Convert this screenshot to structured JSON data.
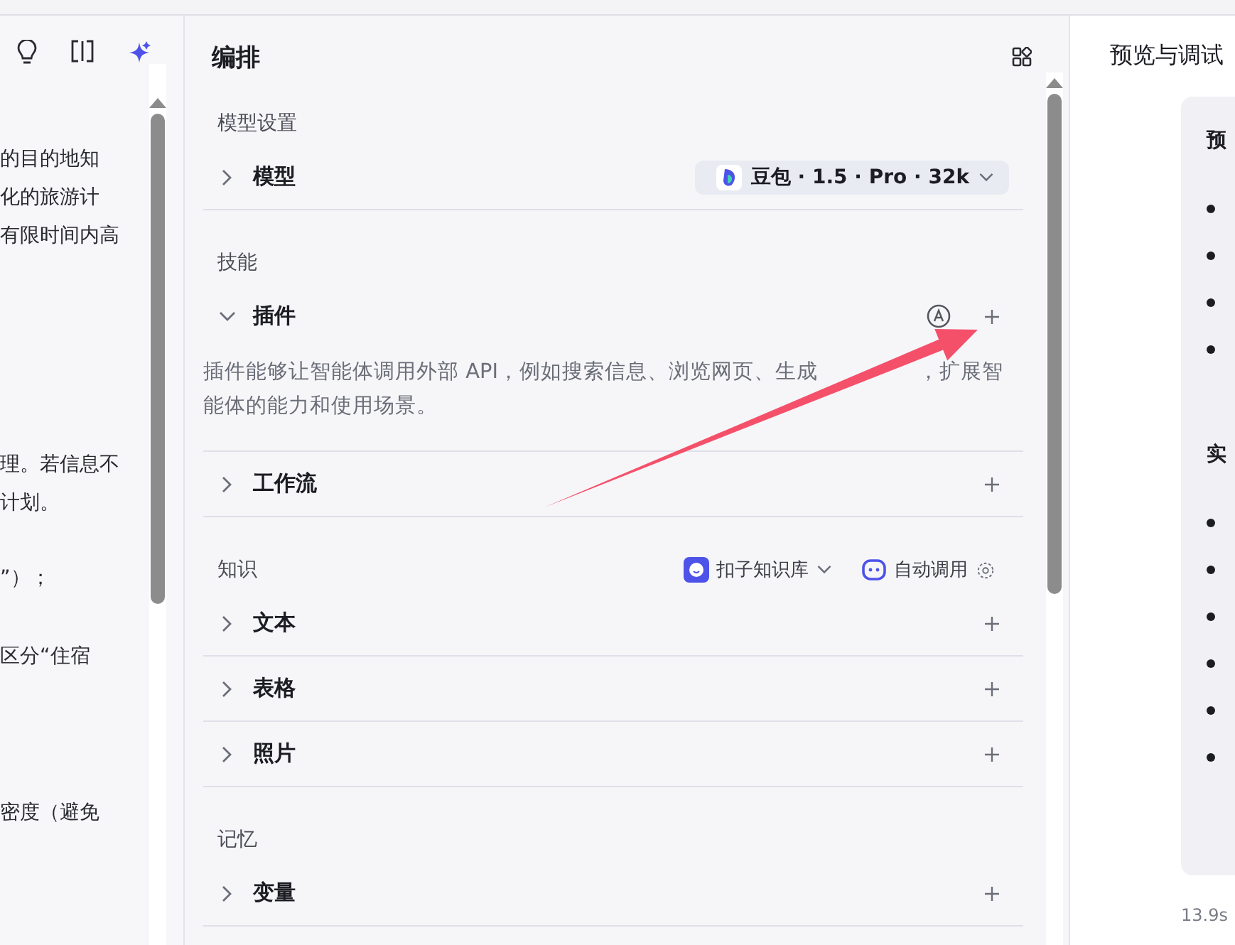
{
  "left_panel": {
    "paragraphs": [
      [
        "的目的地知",
        "化的旅游计",
        "有限时间内高"
      ],
      [
        "理。若信息不",
        "计划。"
      ],
      [
        "”）；"
      ],
      [
        "区分“住宿"
      ],
      [
        "密度（避免"
      ]
    ]
  },
  "editor": {
    "title": "编排",
    "sections": [
      {
        "title": "模型设置",
        "items": [
          {
            "kind": "model",
            "label": "模型",
            "expanded": false,
            "value": "豆包 · 1.5 · Pro · 32k"
          }
        ]
      },
      {
        "title": "技能",
        "items": [
          {
            "kind": "plugin",
            "label": "插件",
            "expanded": true,
            "description": [
              "插件能够让智能体调用外部 API，例如搜索信息、浏览网页、生成",
              "，扩展智",
              "能体的能力和使用场景。"
            ]
          },
          {
            "kind": "plain",
            "label": "工作流",
            "expanded": false
          }
        ]
      },
      {
        "title": "知识",
        "knowledge_base": "扣子知识库",
        "auto_call": "自动调用",
        "items": [
          {
            "kind": "plain",
            "label": "文本",
            "expanded": false
          },
          {
            "kind": "plain",
            "label": "表格",
            "expanded": false
          },
          {
            "kind": "plain",
            "label": "照片",
            "expanded": false
          }
        ]
      },
      {
        "title": "记忆",
        "items": [
          {
            "kind": "plain",
            "label": "变量",
            "expanded": false
          }
        ]
      }
    ]
  },
  "preview": {
    "title": "预览与调试",
    "headings": [
      "预",
      "实"
    ],
    "elapsed": "13.9s"
  }
}
